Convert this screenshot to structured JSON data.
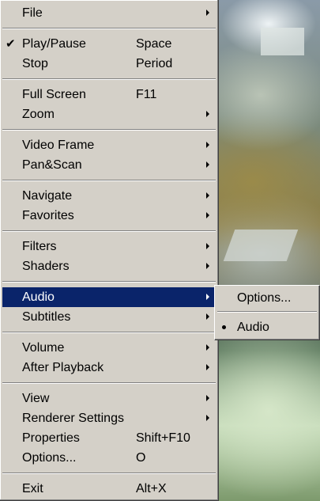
{
  "menu": {
    "file": "File",
    "play_pause": "Play/Pause",
    "play_pause_shortcut": "Space",
    "play_pause_check": "✔",
    "stop": "Stop",
    "stop_shortcut": "Period",
    "full_screen": "Full Screen",
    "full_screen_shortcut": "F11",
    "zoom": "Zoom",
    "video_frame": "Video Frame",
    "pan_scan": "Pan&Scan",
    "navigate": "Navigate",
    "favorites": "Favorites",
    "filters": "Filters",
    "shaders": "Shaders",
    "audio": "Audio",
    "subtitles": "Subtitles",
    "volume": "Volume",
    "after_playback": "After Playback",
    "view": "View",
    "renderer_settings": "Renderer Settings",
    "properties": "Properties",
    "properties_shortcut": "Shift+F10",
    "options": "Options...",
    "options_shortcut": "O",
    "exit": "Exit",
    "exit_shortcut": "Alt+X"
  },
  "audio_submenu": {
    "options": "Options...",
    "audio": "Audio"
  },
  "colors": {
    "menu_bg": "#d4d0c8",
    "highlight": "#0a246a"
  }
}
